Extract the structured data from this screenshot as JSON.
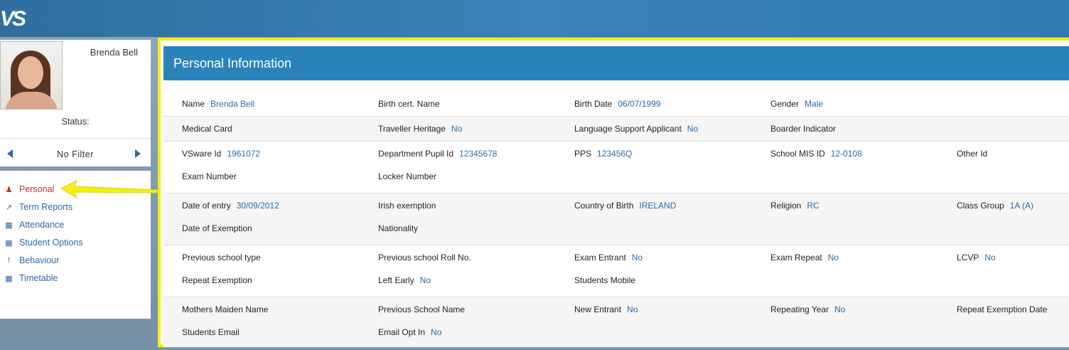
{
  "app": {
    "logo_text": "VS"
  },
  "student": {
    "name": "Brenda Bell",
    "status_label": "Status:"
  },
  "filter": {
    "label": "No Filter"
  },
  "nav": [
    {
      "label": "Personal",
      "icon": "user-icon",
      "active": true
    },
    {
      "label": "Term Reports",
      "icon": "line-chart-icon",
      "active": false
    },
    {
      "label": "Attendance",
      "icon": "calendar-icon",
      "active": false
    },
    {
      "label": "Student Options",
      "icon": "calendar-icon",
      "active": false
    },
    {
      "label": "Behaviour",
      "icon": "exclamation-icon",
      "active": false
    },
    {
      "label": "Timetable",
      "icon": "calendar-icon",
      "active": false
    }
  ],
  "panel": {
    "title": "Personal Information"
  },
  "fields": [
    {
      "label": "Name",
      "value": "Brenda Bell"
    },
    {
      "label": "Birth cert. Name",
      "value": ""
    },
    {
      "label": "Birth Date",
      "value": "06/07/1999"
    },
    {
      "label": "Gender",
      "value": "Male"
    },
    {
      "label": "Medical Card",
      "value": ""
    },
    {
      "label": "Traveller Heritage",
      "value": "No"
    },
    {
      "label": "Language Support Applicant",
      "value": "No"
    },
    {
      "label": "Boarder Indicator",
      "value": ""
    },
    {
      "label": "VSware Id",
      "value": "1961072"
    },
    {
      "label": "Department Pupil Id",
      "value": "12345678"
    },
    {
      "label": "PPS",
      "value": "123456Q"
    },
    {
      "label": "School MIS ID",
      "value": "12-0108"
    },
    {
      "label": "Other Id",
      "value": ""
    },
    {
      "label": "Exam Number",
      "value": ""
    },
    {
      "label": "Locker Number",
      "value": ""
    },
    {
      "label": "Date of entry",
      "value": "30/09/2012"
    },
    {
      "label": "Irish exemption",
      "value": ""
    },
    {
      "label": "Country of Birth",
      "value": "IRELAND"
    },
    {
      "label": "Religion",
      "value": "RC"
    },
    {
      "label": "Class Group",
      "value": "1A (A)"
    },
    {
      "label": "Date of Exemption",
      "value": ""
    },
    {
      "label": "Nationality",
      "value": ""
    },
    {
      "label": "Previous school type",
      "value": ""
    },
    {
      "label": "Previous school Roll No.",
      "value": ""
    },
    {
      "label": "Exam Entrant",
      "value": "No"
    },
    {
      "label": "Exam Repeat",
      "value": "No"
    },
    {
      "label": "LCVP",
      "value": "No"
    },
    {
      "label": "Repeat Exemption",
      "value": ""
    },
    {
      "label": "Left Early",
      "value": "No"
    },
    {
      "label": "Students Mobile",
      "value": ""
    },
    {
      "label": "Mothers Maiden Name",
      "value": ""
    },
    {
      "label": "Previous School Name",
      "value": ""
    },
    {
      "label": "New Entrant",
      "value": "No"
    },
    {
      "label": "Repeating Year",
      "value": "No"
    },
    {
      "label": "Repeat Exemption Date",
      "value": ""
    },
    {
      "label": "Students Email",
      "value": ""
    },
    {
      "label": "Email Opt In",
      "value": "No"
    }
  ]
}
